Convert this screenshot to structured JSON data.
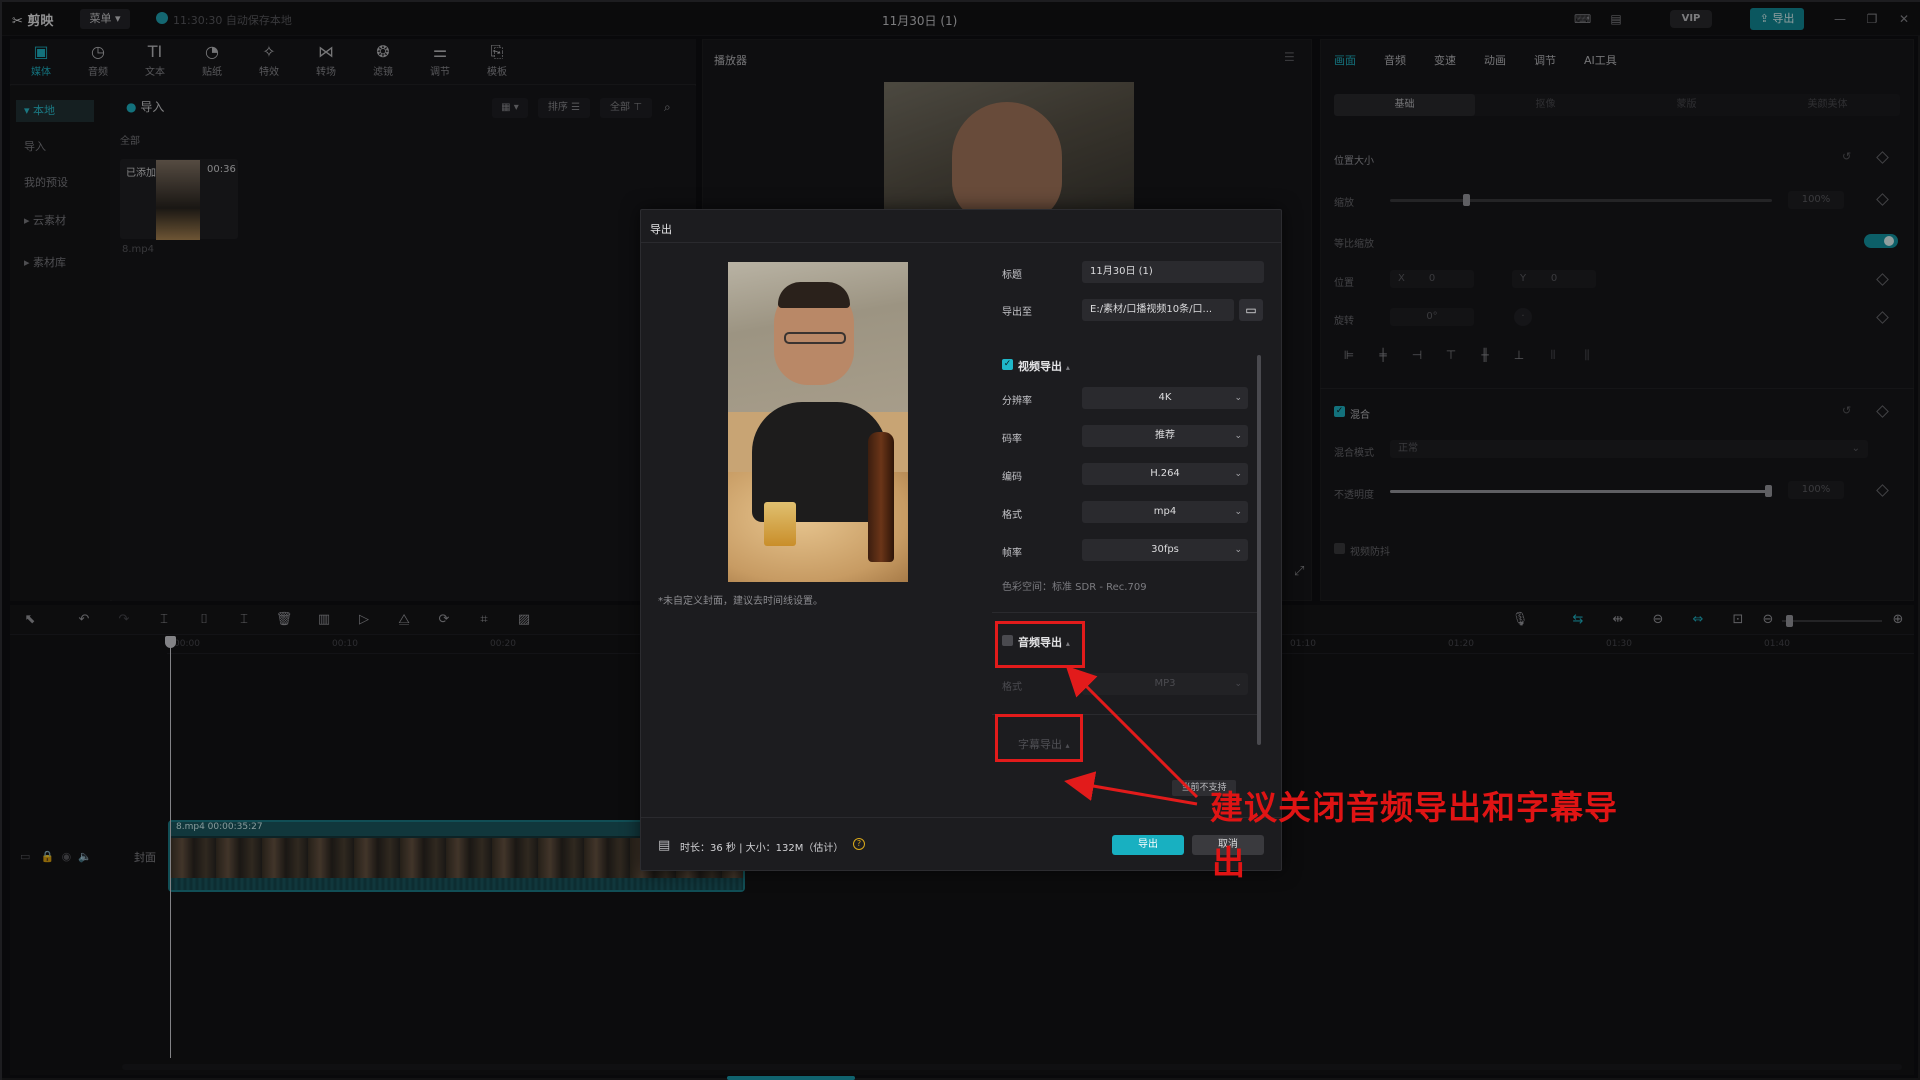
{
  "app": {
    "logo": "剪映",
    "menu": "菜单",
    "autosave": "11:30:30 自动保存本地",
    "project_title": "11月30日 (1)",
    "vip": "VIP",
    "export": "导出"
  },
  "toolbar": {
    "tabs": [
      {
        "label": "媒体",
        "icon": "media-icon",
        "glyph": "▣"
      },
      {
        "label": "音频",
        "icon": "audio-icon",
        "glyph": "◷"
      },
      {
        "label": "文本",
        "icon": "text-icon",
        "glyph": "TI"
      },
      {
        "label": "贴纸",
        "icon": "sticker-icon",
        "glyph": "◔"
      },
      {
        "label": "特效",
        "icon": "effects-icon",
        "glyph": "✧"
      },
      {
        "label": "转场",
        "icon": "transition-icon",
        "glyph": "⋈"
      },
      {
        "label": "滤镜",
        "icon": "filter-icon",
        "glyph": "❂"
      },
      {
        "label": "调节",
        "icon": "adjust-icon",
        "glyph": "⚌"
      },
      {
        "label": "模板",
        "icon": "template-icon",
        "glyph": "⎘"
      }
    ]
  },
  "side_nav": {
    "items": [
      "本地",
      "导入",
      "我的预设",
      "云素材",
      "素材库"
    ]
  },
  "media": {
    "import": "导入",
    "sort": "排序",
    "filter_all": "全部",
    "all_label": "全部",
    "added": "已添加",
    "duration": "00:36",
    "filename": "8.mp4"
  },
  "player": {
    "title": "播放器"
  },
  "properties": {
    "tabs": [
      "画面",
      "音频",
      "变速",
      "动画",
      "调节",
      "AI工具"
    ],
    "subtabs": [
      "基础",
      "抠像",
      "蒙版",
      "美颜美体"
    ],
    "position_size": "位置大小",
    "scale": "缩放",
    "scale_value": "100%",
    "scale_level": 0.2,
    "uniform_scale": "等比缩放",
    "position": "位置",
    "pos_x_label": "X",
    "pos_x": "0",
    "pos_y_label": "Y",
    "pos_y": "0",
    "rotation": "旋转",
    "rotation_value": "0°",
    "blend": "混合",
    "blend_mode": "混合模式",
    "blend_mode_value": "正常",
    "opacity": "不透明度",
    "opacity_value": "100%",
    "opacity_level": 1.0,
    "stabilize": "视频防抖"
  },
  "timeline": {
    "ticks": [
      "00:00",
      "00:10",
      "00:20",
      "01:10",
      "01:20",
      "01:30",
      "01:40"
    ],
    "cover": "封面",
    "clip_label": "8.mp4  00:00:35:27"
  },
  "dialog": {
    "title": "导出",
    "cover_hint": "*未自定义封面，建议去时间线设置。",
    "title_label": "标题",
    "title_value": "11月30日 (1)",
    "export_to_label": "导出至",
    "export_to_value": "E:/素材/口播视频10条/口...",
    "video_section": "视频导出",
    "resolution_label": "分辨率",
    "resolution": "4K",
    "bitrate_label": "码率",
    "bitrate": "推荐",
    "codec_label": "编码",
    "codec": "H.264",
    "format_label": "格式",
    "format": "mp4",
    "fps_label": "帧率",
    "fps": "30fps",
    "colorspace": "色彩空间：标准 SDR - Rec.709",
    "audio_section": "音频导出",
    "audio_format_label": "格式",
    "audio_format": "MP3",
    "subtitle_section": "字幕导出",
    "subtitle_tip": "当前不支持",
    "duration_info": "时长：36 秒 | 大小：132M（估计）",
    "export_button": "导出",
    "cancel_button": "取消"
  },
  "annotation": {
    "line1": "建议关闭音频导出和字幕导",
    "line2": "出",
    "color": "#e01414"
  }
}
